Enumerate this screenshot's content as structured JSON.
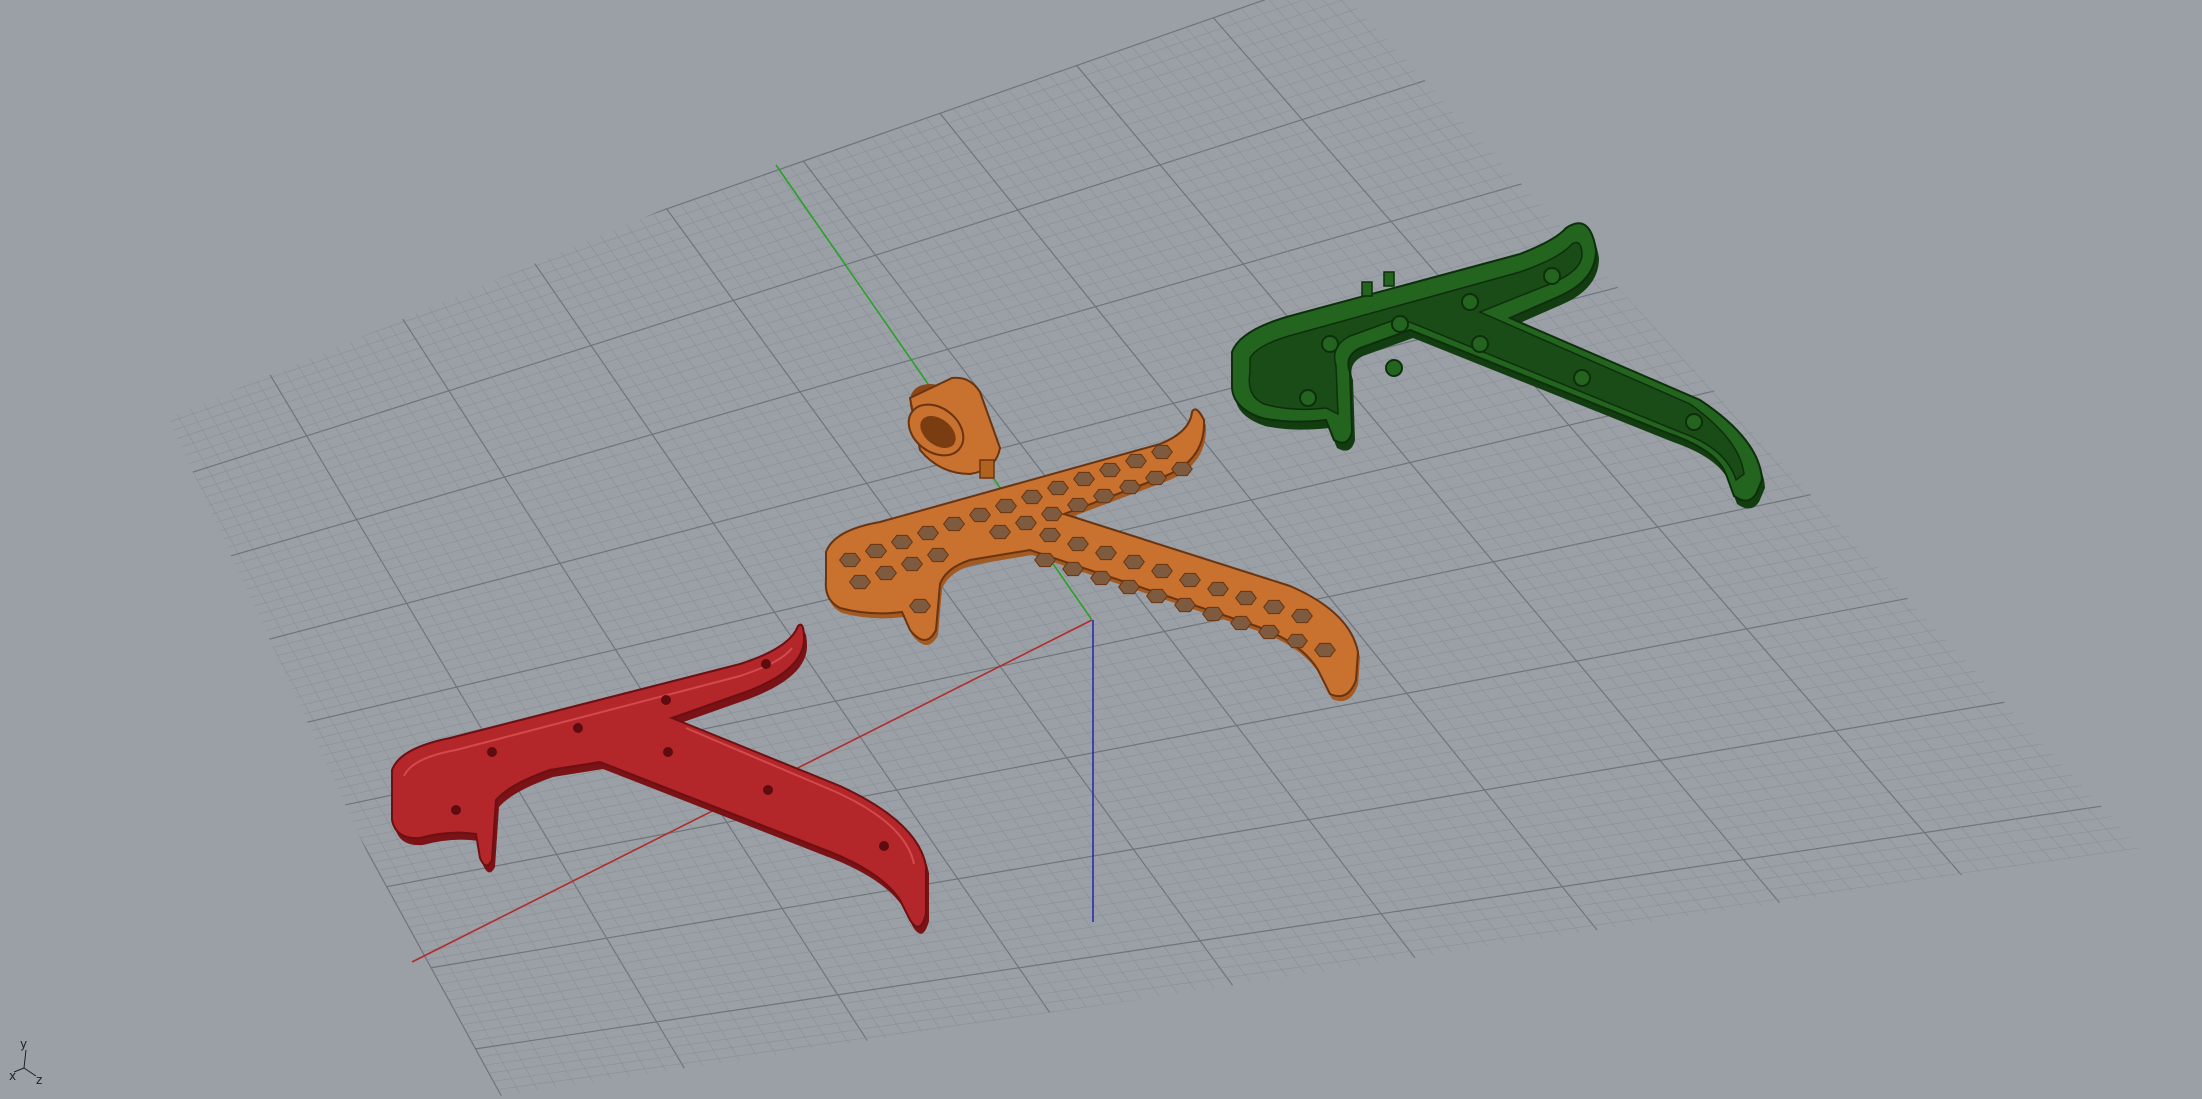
{
  "app": {
    "view": "Perspective"
  },
  "colors": {
    "background": "#9ba0a6",
    "grid_minor": "#8a8f95",
    "grid_major": "#6f747a",
    "axis_x": "#b22a2a",
    "axis_y": "#2aa02a",
    "axis_z": "#2a2ab4",
    "part_red": "#b3262a",
    "part_orange": "#c9712e",
    "part_green": "#23651f"
  },
  "widget": {
    "y_label": "y",
    "x_label": "x",
    "z_label": "z"
  },
  "objects": [
    {
      "id": "red-handle",
      "icon": "solid-part",
      "color": "part_red"
    },
    {
      "id": "orange-honeycomb-handle",
      "icon": "solid-part",
      "color": "part_orange"
    },
    {
      "id": "orange-ring-clip",
      "icon": "solid-part",
      "color": "part_orange"
    },
    {
      "id": "green-frame-handle",
      "icon": "solid-part",
      "color": "part_green"
    }
  ]
}
